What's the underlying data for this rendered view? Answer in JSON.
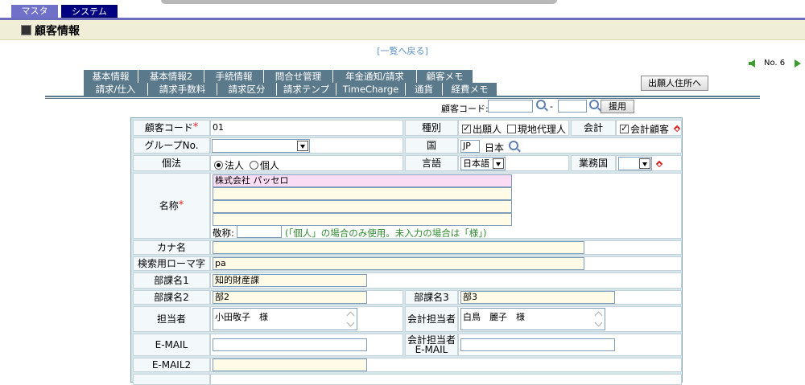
{
  "top_tabs": {
    "master": "マスタ",
    "system": "システム"
  },
  "header": {
    "title": "顧客情報"
  },
  "back_link": "[一覧へ戻る]",
  "record_nav": {
    "label": "No. 6"
  },
  "tabs_row1": [
    "基本情報",
    "基本情報2",
    "手続情報",
    "問合せ管理",
    "年金通知/請求",
    "顧客メモ"
  ],
  "tabs_row2": [
    "請求/仕入",
    "請求手数料",
    "請求区分",
    "請求テンプ",
    "TimeCharge",
    "通貨",
    "経費メモ"
  ],
  "address_button": "出願人住所へ",
  "search": {
    "label": "顧客コード:",
    "from": "",
    "to": "",
    "sep": "-",
    "button": "援用"
  },
  "form": {
    "customer_code": {
      "label": "顧客コード",
      "value": "01"
    },
    "type": {
      "label": "種別",
      "applicant": "出願人",
      "applicant_checked": true,
      "agent": "現地代理人",
      "agent_checked": false
    },
    "accounting": {
      "label": "会計",
      "option": "会計顧客",
      "checked": true
    },
    "group_no": {
      "label": "グループNo.",
      "value": ""
    },
    "country": {
      "label": "国",
      "code": "JP",
      "name": "日本"
    },
    "individual_law": {
      "label": "個法",
      "corp": "法人",
      "person": "個人",
      "selected": "法人"
    },
    "language": {
      "label": "言語",
      "value": "日本語"
    },
    "business_country": {
      "label": "業務国",
      "value": ""
    },
    "name": {
      "label": "名称",
      "lines": [
        "株式会社 パッセロ",
        "",
        "",
        ""
      ]
    },
    "honorific": {
      "label": "敬称:",
      "value": "",
      "note": "(「個人」の場合のみ使用。未入力の場合は「様」)"
    },
    "kana": {
      "label": "カナ名",
      "value": ""
    },
    "romaji": {
      "label": "検索用ローマ字",
      "value": "pa"
    },
    "dept1": {
      "label": "部課名1",
      "value": "知的財産課"
    },
    "dept2": {
      "label": "部課名2",
      "value": "部2"
    },
    "dept3": {
      "label": "部課名3",
      "value": "部3"
    },
    "contact": {
      "label": "担当者",
      "value": "小田敬子　様"
    },
    "acct_contact": {
      "label": "会計担当者",
      "value": "白鳥　麗子　様"
    },
    "email": {
      "label": "E-MAIL",
      "value": ""
    },
    "acct_email": {
      "label": "会計担当者",
      "label2": "E-MAIL",
      "value": ""
    },
    "email2": {
      "label": "E-MAIL2",
      "value": ""
    }
  },
  "colors": {
    "nav_accent": "#000080",
    "tab_bg": "#5a7a8c",
    "header_bg": "#f1eed8",
    "form_bg": "#d6e6ea",
    "link": "#5d8fc9",
    "required": "#e02020"
  },
  "icons": [
    "search-icon",
    "arrow-left-icon",
    "arrow-right-icon",
    "dropdown-icon",
    "required-diamond-icon"
  ]
}
